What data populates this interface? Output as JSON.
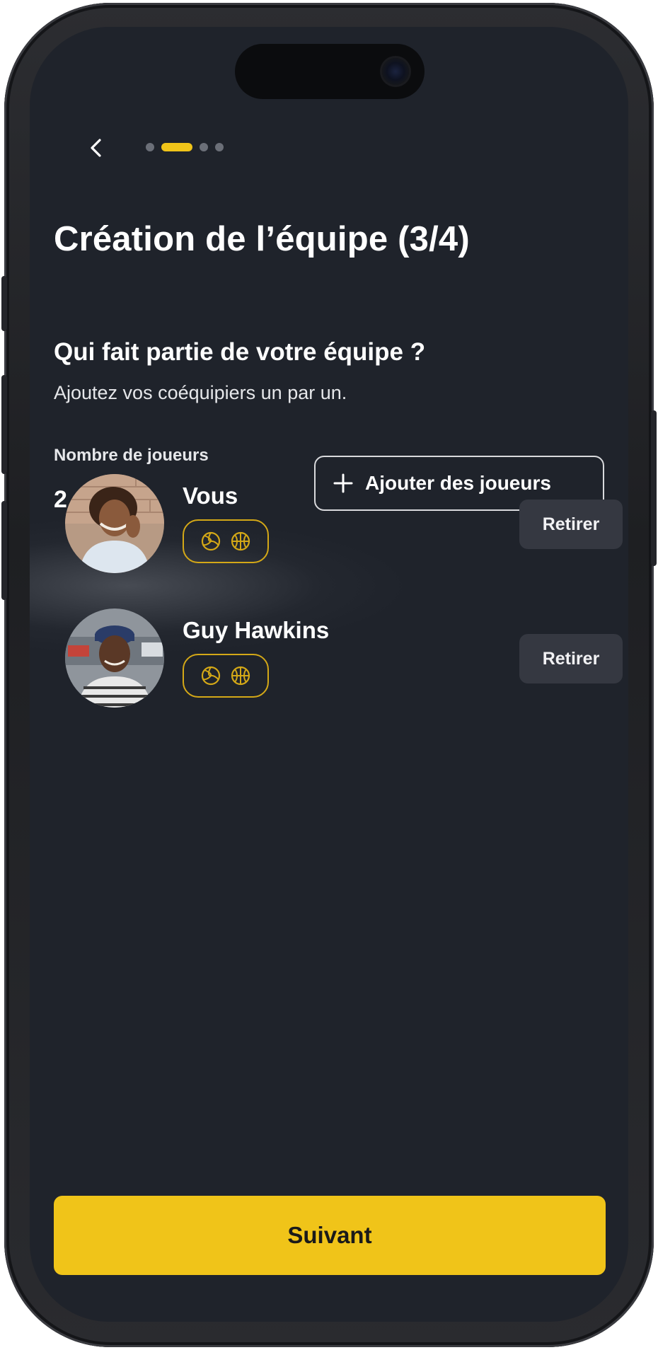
{
  "header": {
    "back_icon": "chevron-left-icon",
    "steps_total": 4,
    "steps_current": 2
  },
  "page": {
    "title": "Création de l’équipe (3/4)",
    "question": "Qui fait partie de votre équipe ?",
    "subtitle": "Ajoutez vos coéquipiers un par un."
  },
  "team": {
    "count_label": "Nombre de joueurs",
    "count_value": "2 / 3",
    "count_icon": "user-icon",
    "add_icon": "plus-icon",
    "add_button_label": "Ajouter des joueurs"
  },
  "players": [
    {
      "name": "Vous",
      "sports": [
        "volleyball-icon",
        "basketball-icon"
      ],
      "remove_label": "Retirer"
    },
    {
      "name": "Guy Hawkins",
      "sports": [
        "volleyball-icon",
        "basketball-icon"
      ],
      "remove_label": "Retirer"
    }
  ],
  "footer": {
    "next_label": "Suivant"
  },
  "colors": {
    "background": "#1f232b",
    "accent": "#f0c419",
    "badge_border": "#d4a817",
    "remove_button": "#353841",
    "inactive_dot": "#6b6f78"
  }
}
